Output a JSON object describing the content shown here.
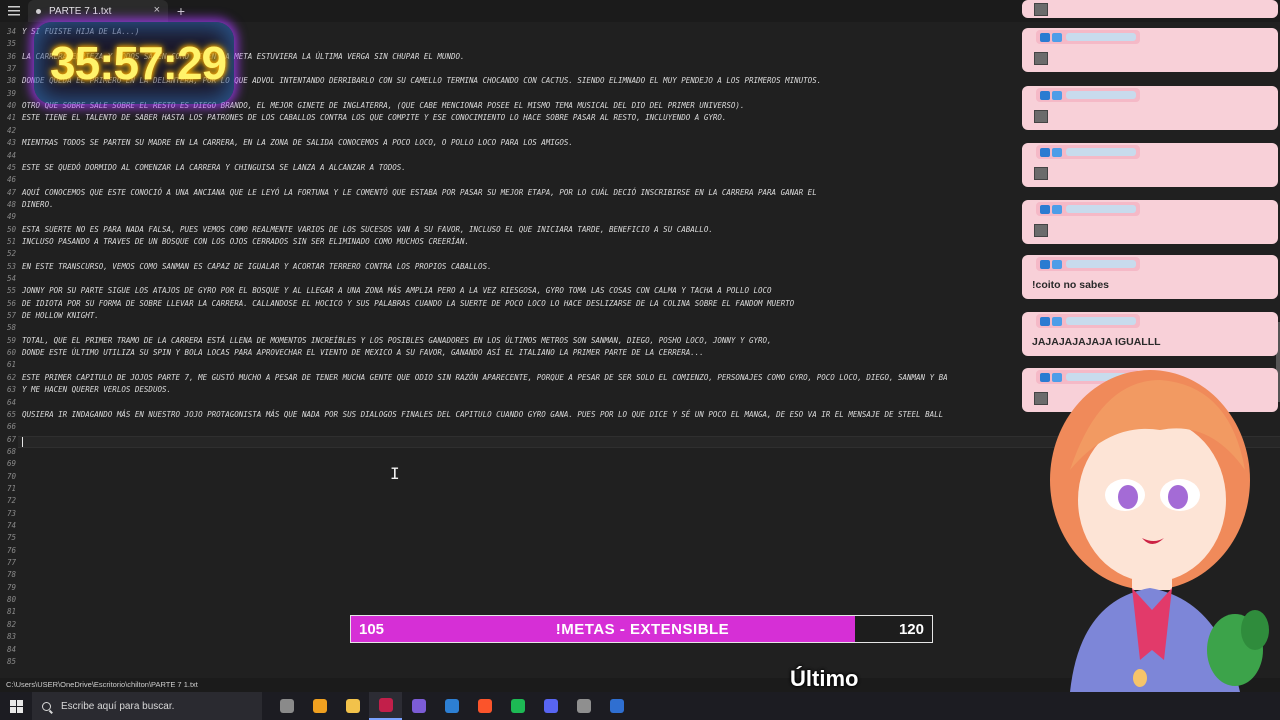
{
  "window": {
    "tab_title": "PARTE 7 1.txt",
    "new_tab_symbol": "+",
    "close_symbol": "×"
  },
  "editor": {
    "lines": [
      {
        "n": "34",
        "t": "Y SI FUISTE HIJA DE LA...)"
      },
      {
        "n": "35",
        "t": ""
      },
      {
        "n": "36",
        "t": "LA CARRERA EMPIEZA Y TODOS SALEN COMO SI EN LA META ESTUVIERA LA ÚLTIMA VERGA SIN CHUPAR EL MUNDO."
      },
      {
        "n": "37",
        "t": ""
      },
      {
        "n": "38",
        "t": "DONDE QUEDA EL PRIMERO EN LA DELANTERA, POR LO QUE ADVOL INTENTANDO DERRIBARLO CON SU CAMELLO TERMINA CHOCANDO CON CACTUS. SIENDO ELIMNADO EL MUY PENDEJO A LOS PRIMEROS MINUTOS."
      },
      {
        "n": "39",
        "t": ""
      },
      {
        "n": "40",
        "t": "OTRO QUE SOBRE SALE SOBRE EL RESTO ES DIEGO BRANDO, EL MEJOR GINETE DE INGLATERRA, (QUE CABE MENCIONAR POSEE EL MISMO TEMA MUSICAL DEL DIO DEL PRIMER UNIVERSO)."
      },
      {
        "n": "41",
        "t": "ESTE TIENE EL TALENTO DE SABER HASTA LOS PATRONES DE LOS CABALLOS CONTRA LOS QUE COMPITE Y ESE CONOCIMIENTO LO HACE SOBRE PASAR AL RESTO, INCLUYENDO A GYRO."
      },
      {
        "n": "42",
        "t": ""
      },
      {
        "n": "43",
        "t": "MIENTRAS TODOS SE PARTEN SU MADRE EN LA CARRERA, EN LA ZONA DE SALIDA CONOCEMOS A POCO LOCO, O POLLO LOCO PARA LOS AMIGOS."
      },
      {
        "n": "44",
        "t": ""
      },
      {
        "n": "45",
        "t": "ESTE SE QUEDÓ DORMIDO AL COMENZAR LA CARRERA Y CHINGUISA SE LANZA A ALCANZAR A TODOS."
      },
      {
        "n": "46",
        "t": ""
      },
      {
        "n": "47",
        "t": "AQUÍ CONOCEMOS QUE ESTE CONOCIÓ A UNA ANCIANA QUE LE LEYÓ LA FORTUNA Y LE COMENTÓ QUE ESTABA POR PASAR SU MEJOR ETAPA, POR LO CUÁL DECIÓ INSCRIBIRSE EN LA CARRERA PARA GANAR EL"
      },
      {
        "n": "48",
        "t": "DINERO."
      },
      {
        "n": "49",
        "t": ""
      },
      {
        "n": "50",
        "t": "ESTA SUERTE NO ES PARA NADA FALSA, PUES VEMOS COMO REALMENTE VARIOS DE LOS SUCESOS VAN A SU FAVOR, INCLUSO EL QUE INICIARA TARDE, BENEFICIO A SU CABALLO."
      },
      {
        "n": "51",
        "t": "INCLUSO PASANDO A TRAVES DE UN BOSQUE CON LOS OJOS CERRADOS SIN SER ELIMINADO COMO MUCHOS CREERÍAN."
      },
      {
        "n": "52",
        "t": ""
      },
      {
        "n": "53",
        "t": "EN ESTE TRANSCURSO, VEMOS COMO SANMAN ES CAPAZ DE IGUALAR Y ACORTAR TERRERO CONTRA LOS PROPIOS CABALLOS."
      },
      {
        "n": "54",
        "t": ""
      },
      {
        "n": "55",
        "t": "JONNY POR SU PARTE SIGUE LOS ATAJOS DE GYRO POR EL BOSQUE Y AL LLEGAR A UNA ZONA MÁS AMPLIA PERO A LA VEZ RIESGOSA, GYRO TOMA LAS COSAS CON CALMA Y TACHA A POLLO LOCO"
      },
      {
        "n": "56",
        "t": "DE IDIOTA POR SU FORMA DE SOBRE LLEVAR LA CARRERA. CALLANDOSE EL HOCICO Y SUS PALABRAS CUANDO LA SUERTE DE POCO LOCO LO HACE DESLIZARSE DE LA COLINA SOBRE EL FANDOM MUERTO"
      },
      {
        "n": "57",
        "t": "DE HOLLOW KNIGHT."
      },
      {
        "n": "58",
        "t": ""
      },
      {
        "n": "59",
        "t": "TOTAL, QUE EL PRIMER TRAMO DE LA CARRERA ESTÁ LLENA DE MOMENTOS INCREÍBLES Y LOS POSIBLES GANADORES EN LOS ÚLTIMOS METROS SON SANMAN, DIEGO, POSHO LOCO, JONNY Y GYRO,"
      },
      {
        "n": "60",
        "t": "DONDE ESTE ÚLTIMO UTILIZA SU SPIN Y BOLA LOCAS PARA APROVECHAR EL VIENTO DE MEXICO A SU FAVOR, GANANDO ASÍ EL ITALIANO LA PRIMER PARTE DE LA CERRERA..."
      },
      {
        "n": "61",
        "t": ""
      },
      {
        "n": "62",
        "t": "ESTE PRIMER CAPITULO DE JOJOS PARTE 7, ME GUSTÓ MUCHO A PESAR DE TENER MUCHA GENTE QUE ODIO SIN RAZÓN APARECENTE, PORQUE A PESAR DE SER SOLO EL COMIENZO, PERSONAJES COMO GYRO, POCO LOCO, DIEGO, SANMAN Y BA"
      },
      {
        "n": "63",
        "t": "Y ME HACEN QUERER VERLOS DESDUOS."
      },
      {
        "n": "64",
        "t": ""
      },
      {
        "n": "65",
        "t": "QUSIERA IR INDAGANDO MÁS EN NUESTRO JOJO PROTAGONISTA MÁS QUE NADA POR SUS DIALOGOS FINALES DEL CAPITULO CUANDO GYRO GANA. PUES POR LO QUE DICE Y SÉ UN POCO EL MANGA, DE ESO VA IR EL MENSAJE DE STEEL BALL"
      },
      {
        "n": "66",
        "t": ""
      },
      {
        "n": "67",
        "t": ""
      },
      {
        "n": "68",
        "t": ""
      },
      {
        "n": "69",
        "t": ""
      },
      {
        "n": "70",
        "t": ""
      },
      {
        "n": "71",
        "t": ""
      },
      {
        "n": "72",
        "t": ""
      },
      {
        "n": "73",
        "t": ""
      },
      {
        "n": "74",
        "t": ""
      },
      {
        "n": "75",
        "t": ""
      },
      {
        "n": "76",
        "t": ""
      },
      {
        "n": "77",
        "t": ""
      },
      {
        "n": "78",
        "t": ""
      },
      {
        "n": "79",
        "t": ""
      },
      {
        "n": "80",
        "t": ""
      },
      {
        "n": "81",
        "t": ""
      },
      {
        "n": "82",
        "t": ""
      },
      {
        "n": "83",
        "t": ""
      },
      {
        "n": "84",
        "t": ""
      },
      {
        "n": "85",
        "t": ""
      }
    ]
  },
  "statusbar": {
    "path": "C:\\Users\\USER\\OneDrive\\Escritorio\\chilton\\PARTE 7 1.txt"
  },
  "taskbar": {
    "search_placeholder": "Escribe aquí para buscar.",
    "icons": [
      {
        "name": "settings-app-icon",
        "color": "#8a8a8a"
      },
      {
        "name": "medal-app-icon",
        "color": "#f0a020"
      },
      {
        "name": "file-explorer-icon",
        "color": "#f2c24b"
      },
      {
        "name": "notepad-icon",
        "color": "#c21f4a"
      },
      {
        "name": "pen-app-icon",
        "color": "#7c5cd6"
      },
      {
        "name": "store-icon",
        "color": "#2d7fd3"
      },
      {
        "name": "brave-browser-icon",
        "color": "#fb542b"
      },
      {
        "name": "spotify-icon",
        "color": "#1db954"
      },
      {
        "name": "discord-icon",
        "color": "#5865f2"
      },
      {
        "name": "obs-icon",
        "color": "#8f8f8f"
      },
      {
        "name": "streaming-app-icon",
        "color": "#2f6fd1"
      }
    ]
  },
  "timer": {
    "value": "35:57:29"
  },
  "goal": {
    "current": "105",
    "label": "!METAS - EXTENSIBLE",
    "target": "120",
    "progress": 0.867,
    "fill_color": "#d62fd6"
  },
  "chat": {
    "messages": [
      {
        "text": ""
      },
      {
        "text": ""
      },
      {
        "text": ""
      },
      {
        "text": ""
      },
      {
        "text": "!coito no sabes"
      },
      {
        "text": "JAJAJAJAJAJA IGUALLL"
      },
      {
        "text": ""
      }
    ]
  },
  "overlay": {
    "ultimo_label": "Último"
  },
  "colors": {
    "editor_bg": "#202020",
    "chat_bubble": "#f8d0d8",
    "timer_text": "#fff36a"
  }
}
